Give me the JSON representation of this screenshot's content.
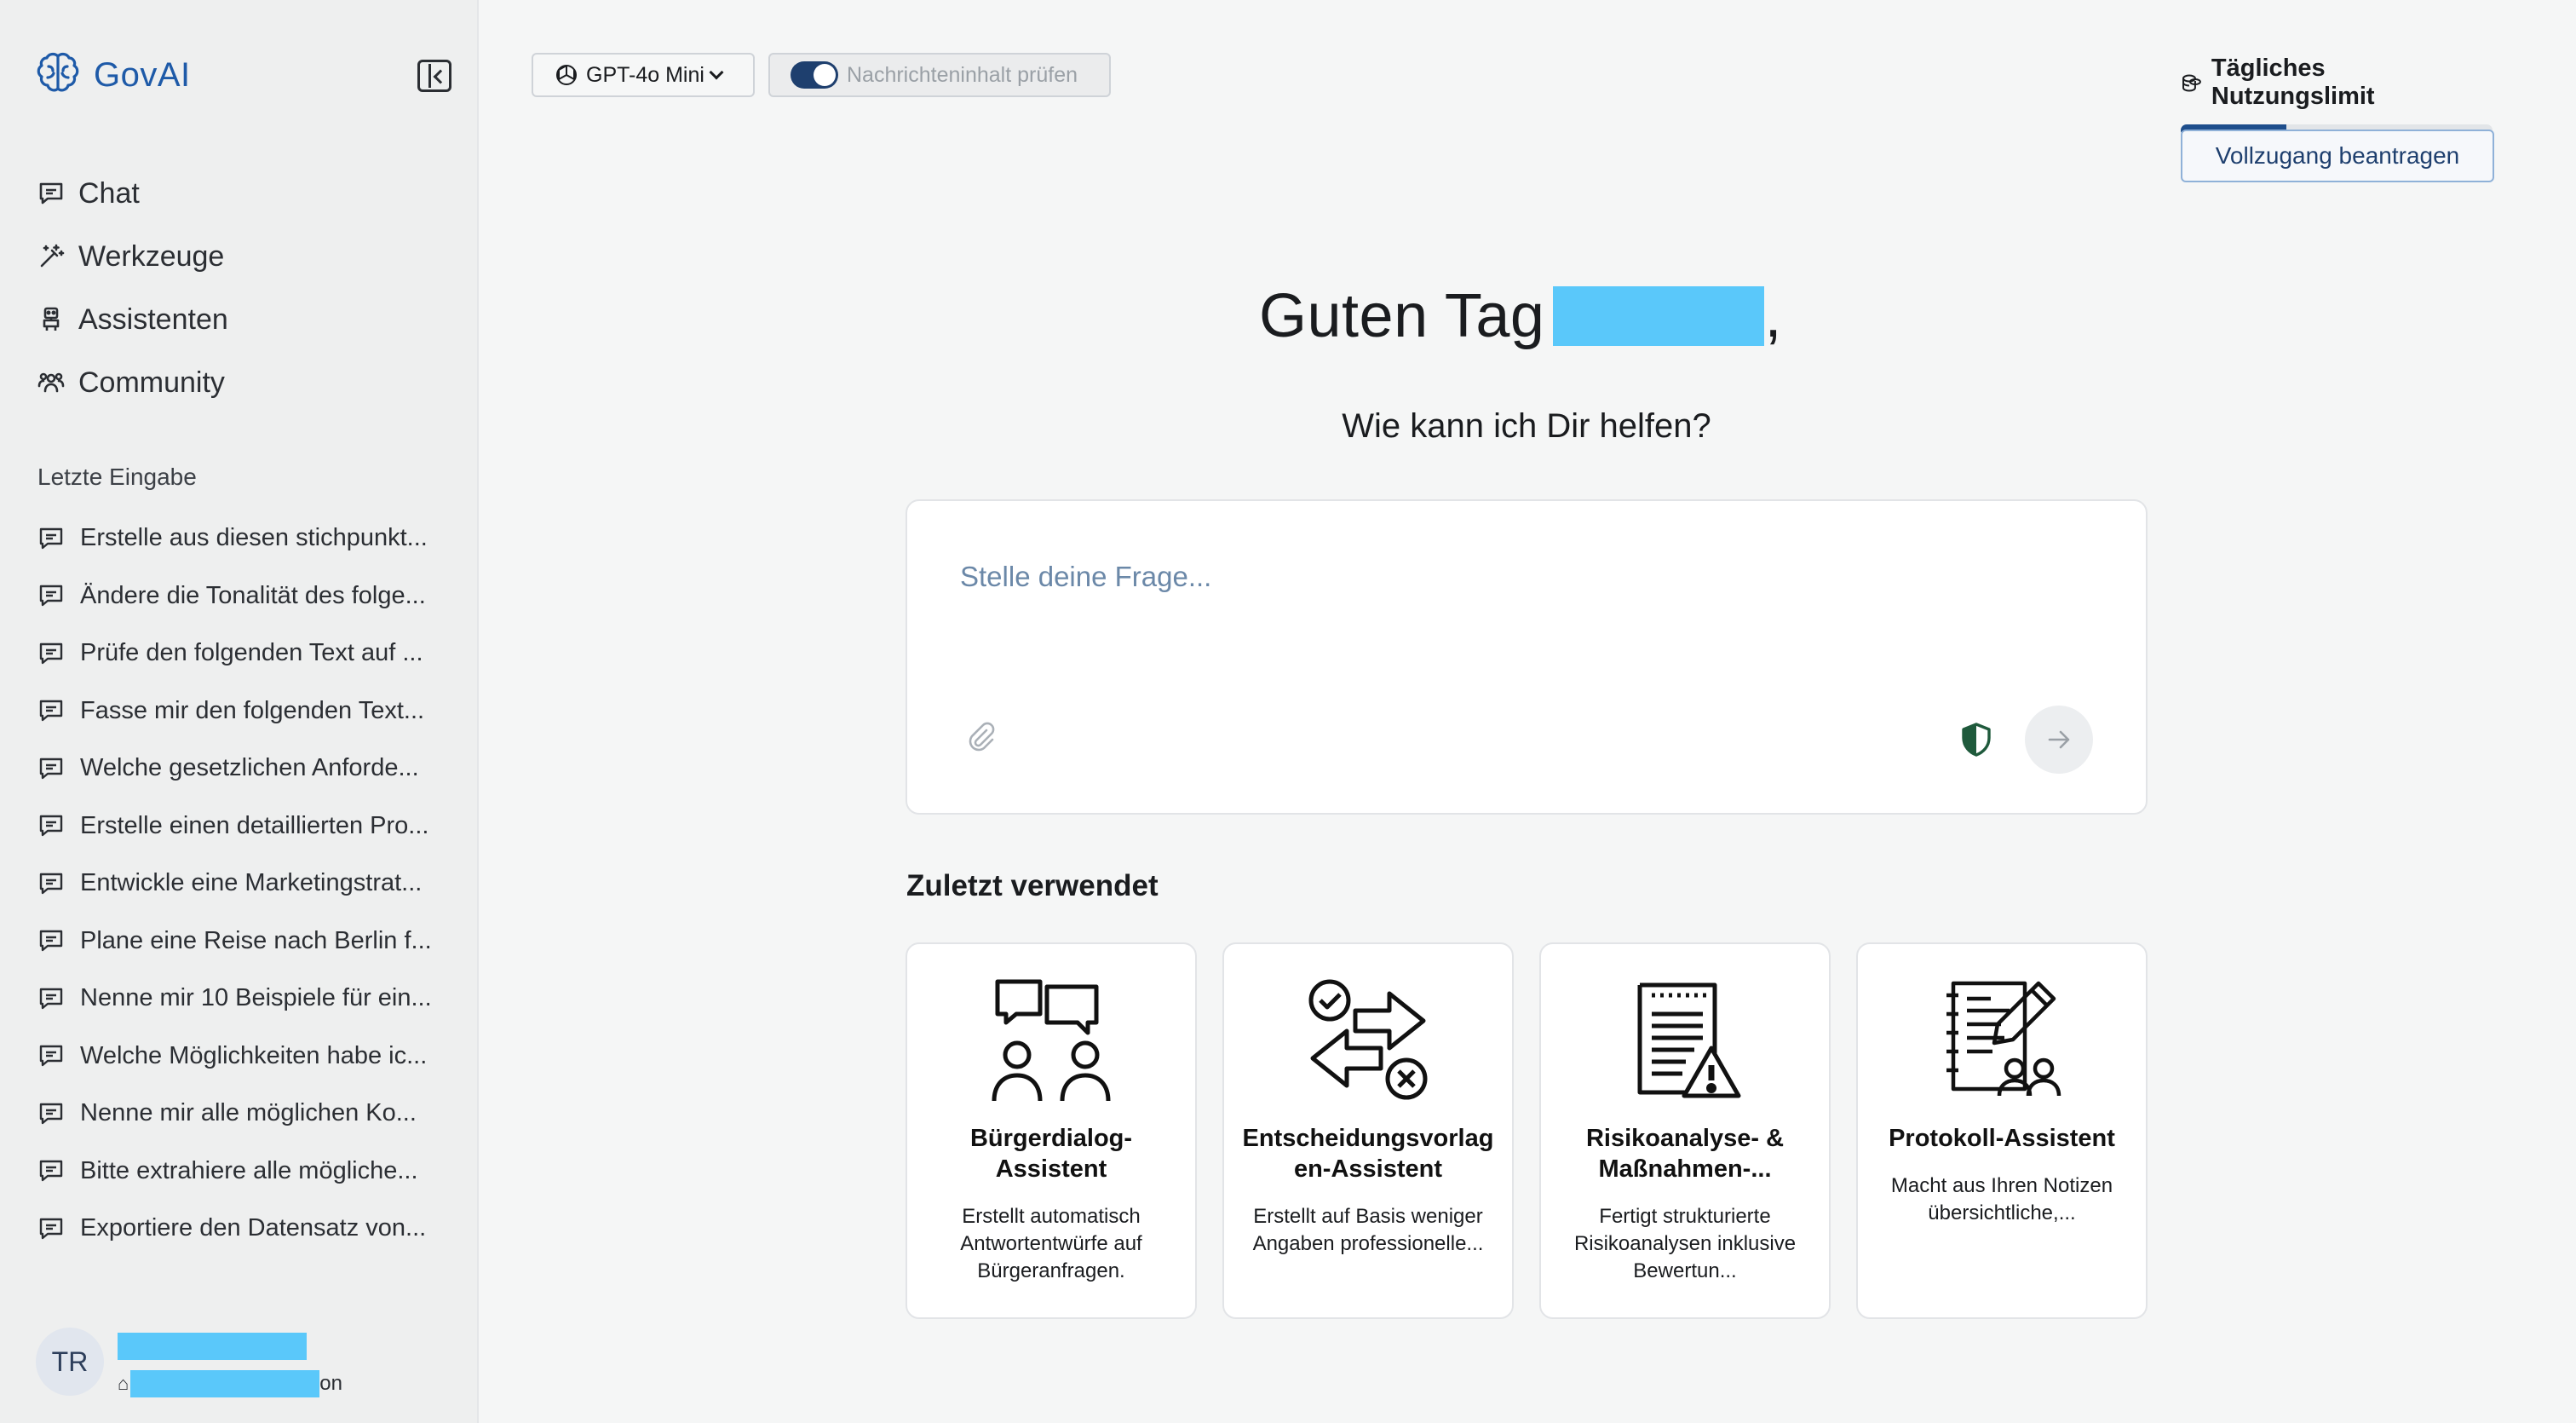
{
  "app": {
    "name": "GovAI"
  },
  "sidebar": {
    "nav": [
      {
        "label": "Chat",
        "icon": "chat-icon"
      },
      {
        "label": "Werkzeuge",
        "icon": "wand-icon"
      },
      {
        "label": "Assistenten",
        "icon": "robot-icon"
      },
      {
        "label": "Community",
        "icon": "people-icon"
      }
    ],
    "recent_title": "Letzte Eingabe",
    "recent": [
      "Erstelle aus diesen stichpunkt...",
      "Ändere die Tonalität des folge...",
      "Prüfe den folgenden Text auf ...",
      "Fasse mir den folgenden Text...",
      "Welche gesetzlichen Anforde...",
      "Erstelle einen detaillierten Pro...",
      "Entwickle eine Marketingstrat...",
      "Plane eine Reise nach Berlin f...",
      "Nenne mir 10 Beispiele für ein...",
      "Welche Möglichkeiten habe ic...",
      "Nenne mir alle möglichen Ko...",
      "Bitte extrahiere alle mögliche...",
      "Exportiere den Datensatz von..."
    ],
    "user": {
      "initials": "TR",
      "org_suffix": "on"
    }
  },
  "topbar": {
    "model_label": "GPT-4o Mini",
    "toggle_label": "Nachrichteninhalt prüfen",
    "limit_title": "Tägliches Nutzungslimit",
    "limit_fraction": 0.34,
    "access_button": "Vollzugang beantragen"
  },
  "main": {
    "greeting": "Guten Tag",
    "comma": ",",
    "subtitle": "Wie kann ich Dir helfen?",
    "prompt_placeholder": "Stelle deine Frage...",
    "recent_used_title": "Zuletzt verwendet",
    "cards": [
      {
        "title": "Bürgerdialog-Assistent",
        "desc": "Erstellt automatisch Antwortentwürfe auf Bürgeranfragen.",
        "icon": "dialog-icon"
      },
      {
        "title": "Entscheidungsvorlagen-Assistent",
        "desc": "Erstellt auf Basis weniger Angaben professionelle...",
        "icon": "decision-icon"
      },
      {
        "title": "Risikoanalyse- & Maßnahmen-...",
        "desc": "Fertigt strukturierte Risikoanalysen inklusive Bewertun...",
        "icon": "risk-document-icon"
      },
      {
        "title": "Protokoll-Assistent",
        "desc": "Macht aus Ihren Notizen übersichtliche,...",
        "icon": "protocol-icon"
      }
    ]
  },
  "colors": {
    "brand": "#1e5aa8",
    "accent_dark": "#1e3f6e",
    "shield": "#1f5a3c",
    "redaction": "#5ac8fa"
  }
}
